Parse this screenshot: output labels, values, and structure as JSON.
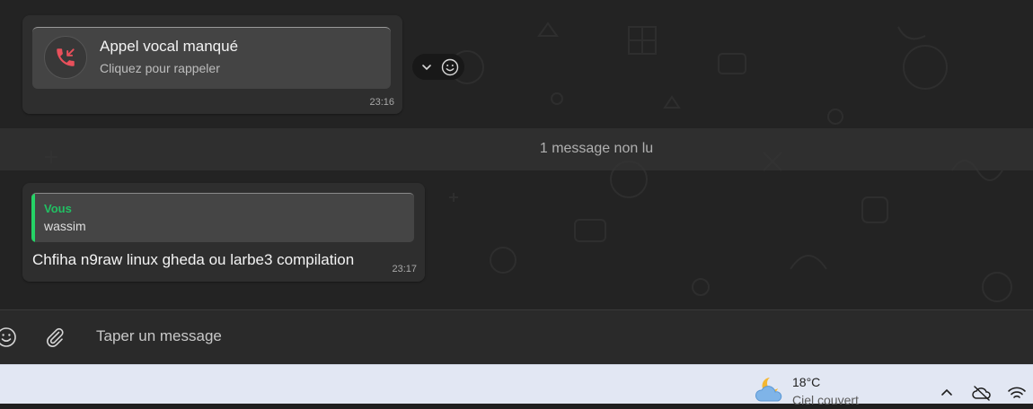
{
  "call": {
    "title": "Appel vocal manqué",
    "subtitle": "Cliquez pour rappeler",
    "time": "23:16"
  },
  "unread_divider": "1 message non lu",
  "message": {
    "quote_author": "Vous",
    "quote_text": "wassim",
    "text": "Chfiha n9raw linux gheda ou larbe3 compilation",
    "time": "23:17"
  },
  "composer": {
    "placeholder": "Taper un message"
  },
  "taskbar": {
    "temperature": "18°C",
    "condition": "Ciel couvert"
  },
  "icons": {
    "missed_call": "phone-missed-icon",
    "reaction": "smiley-icon",
    "menu": "chevron-down-icon",
    "emoji": "smiley-icon",
    "attach": "paperclip-icon",
    "weather": "partly-cloudy-night-icon",
    "tray_up": "chevron-up-icon",
    "cloud": "cloud-off-icon",
    "wifi": "wifi-icon"
  },
  "colors": {
    "accent_green": "#21c063",
    "missed_call_red": "#e8505b",
    "chat_background": "#232323",
    "bubble": "#2e2e2e"
  }
}
